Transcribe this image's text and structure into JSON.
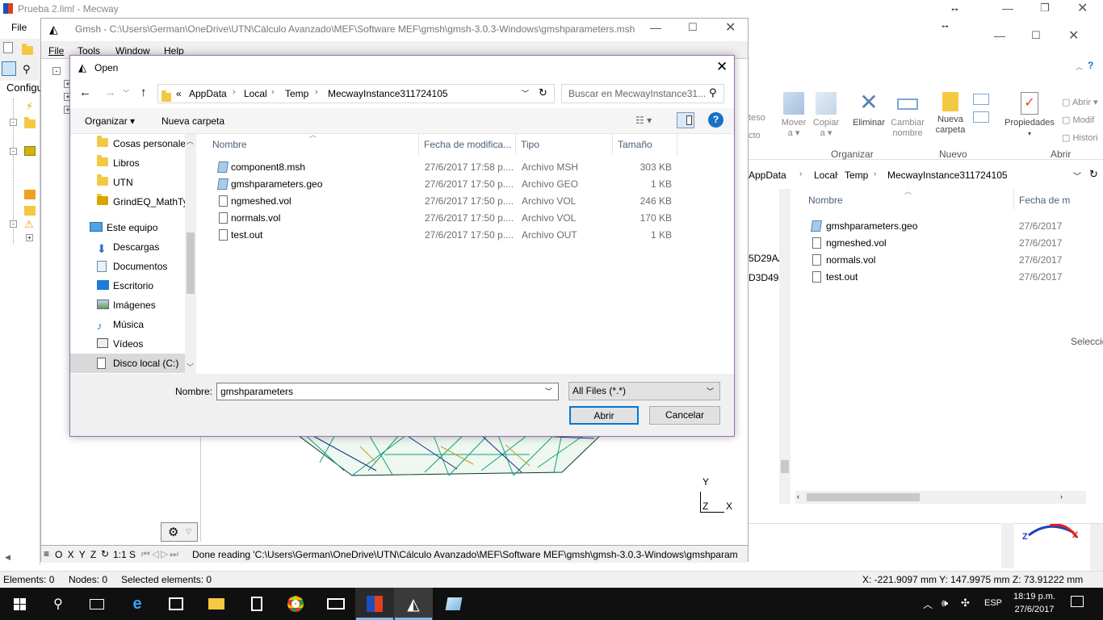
{
  "mecway": {
    "title": "Prueba 2.liml - Mecway",
    "menu_file": "File",
    "tab_config": "Configu",
    "status": {
      "elements": "Elements: 0",
      "nodes": "Nodes: 0",
      "selected": "Selected elements: 0",
      "coords": "X: -221.9097 mm Y: 147.9975 mm Z: 73.91222 mm"
    }
  },
  "gmsh": {
    "title": "Gmsh - C:\\Users\\German\\OneDrive\\UTN\\Cálculo Avanzado\\MEF\\Software MEF\\gmsh\\gmsh-3.0.3-Windows\\gmshparameters.msh",
    "menu": [
      "File",
      "Tools",
      "Window",
      "Help"
    ],
    "axis_y": "Y",
    "axis_z": "Z",
    "axis_x": "X",
    "status_buttons": "O X Y Z",
    "status_scale": "1:1 S",
    "status_msg": "Done reading 'C:\\Users\\German\\OneDrive\\UTN\\Cálculo Avanzado\\MEF\\Software MEF\\gmsh\\gmsh-3.0.3-Windows\\gmshparam"
  },
  "explorer": {
    "ribbon": {
      "move": "Mover\na ▾",
      "copy": "Copiar\na ▾",
      "delete": "Eliminar",
      "rename": "Cambiar\nnombre",
      "new_folder": "Nueva\ncarpeta",
      "properties": "Propiedades",
      "open": "Abrir",
      "modify": "Modif",
      "history": "Histori",
      "group_organize": "Organizar",
      "group_new": "Nuevo",
      "group_open": "Abrir",
      "cut_text1": "teso",
      "cut_text2": "cto"
    },
    "breadcrumb": [
      "AppData",
      "Local",
      "Temp",
      "MecwayInstance311724105"
    ],
    "col_name": "Nombre",
    "col_date": "Fecha de m",
    "left_ids": [
      "5D29AA",
      "D3D494"
    ],
    "files": [
      {
        "name": "gmshparameters.geo",
        "date": "27/6/2017"
      },
      {
        "name": "ngmeshed.vol",
        "date": "27/6/2017"
      },
      {
        "name": "normals.vol",
        "date": "27/6/2017"
      },
      {
        "name": "test.out",
        "date": "27/6/2017"
      }
    ],
    "selection_hint": "Seleccio"
  },
  "dialog": {
    "title": "Open",
    "breadcrumb_prefix": "«",
    "breadcrumb": [
      "AppData",
      "Local",
      "Temp",
      "MecwayInstance311724105"
    ],
    "search_placeholder": "Buscar en MecwayInstance31...",
    "organize": "Organizar ▾",
    "new_folder": "Nueva carpeta",
    "sidebar": [
      {
        "label": "Cosas personale",
        "icon": "folder"
      },
      {
        "label": "Libros",
        "icon": "folder"
      },
      {
        "label": "UTN",
        "icon": "folder"
      },
      {
        "label": "GrindEQ_MathTy",
        "icon": "folder"
      },
      {
        "label": "Este equipo",
        "icon": "computer"
      },
      {
        "label": "Descargas",
        "icon": "download"
      },
      {
        "label": "Documentos",
        "icon": "document"
      },
      {
        "label": "Escritorio",
        "icon": "desktop"
      },
      {
        "label": "Imágenes",
        "icon": "image"
      },
      {
        "label": "Música",
        "icon": "music"
      },
      {
        "label": "Vídeos",
        "icon": "video"
      },
      {
        "label": "Disco local (C:)",
        "icon": "drive"
      }
    ],
    "columns": {
      "name": "Nombre",
      "date": "Fecha de modifica...",
      "type": "Tipo",
      "size": "Tamaño"
    },
    "files": [
      {
        "name": "component8.msh",
        "date": "27/6/2017 17:58 p....",
        "type": "Archivo MSH",
        "size": "303 KB",
        "icon": "msh"
      },
      {
        "name": "gmshparameters.geo",
        "date": "27/6/2017 17:50 p....",
        "type": "Archivo GEO",
        "size": "1 KB",
        "icon": "msh"
      },
      {
        "name": "ngmeshed.vol",
        "date": "27/6/2017 17:50 p....",
        "type": "Archivo VOL",
        "size": "246 KB",
        "icon": "doc"
      },
      {
        "name": "normals.vol",
        "date": "27/6/2017 17:50 p....",
        "type": "Archivo VOL",
        "size": "170 KB",
        "icon": "doc"
      },
      {
        "name": "test.out",
        "date": "27/6/2017 17:50 p....",
        "type": "Archivo OUT",
        "size": "1 KB",
        "icon": "doc"
      }
    ],
    "filename_label": "Nombre:",
    "filename_value": "gmshparameters",
    "filter": "All Files (*.*)",
    "open_btn": "Abrir",
    "cancel_btn": "Cancelar"
  },
  "taskbar": {
    "lang": "ESP",
    "time": "18:19 p.m.",
    "date": "27/6/2017"
  }
}
